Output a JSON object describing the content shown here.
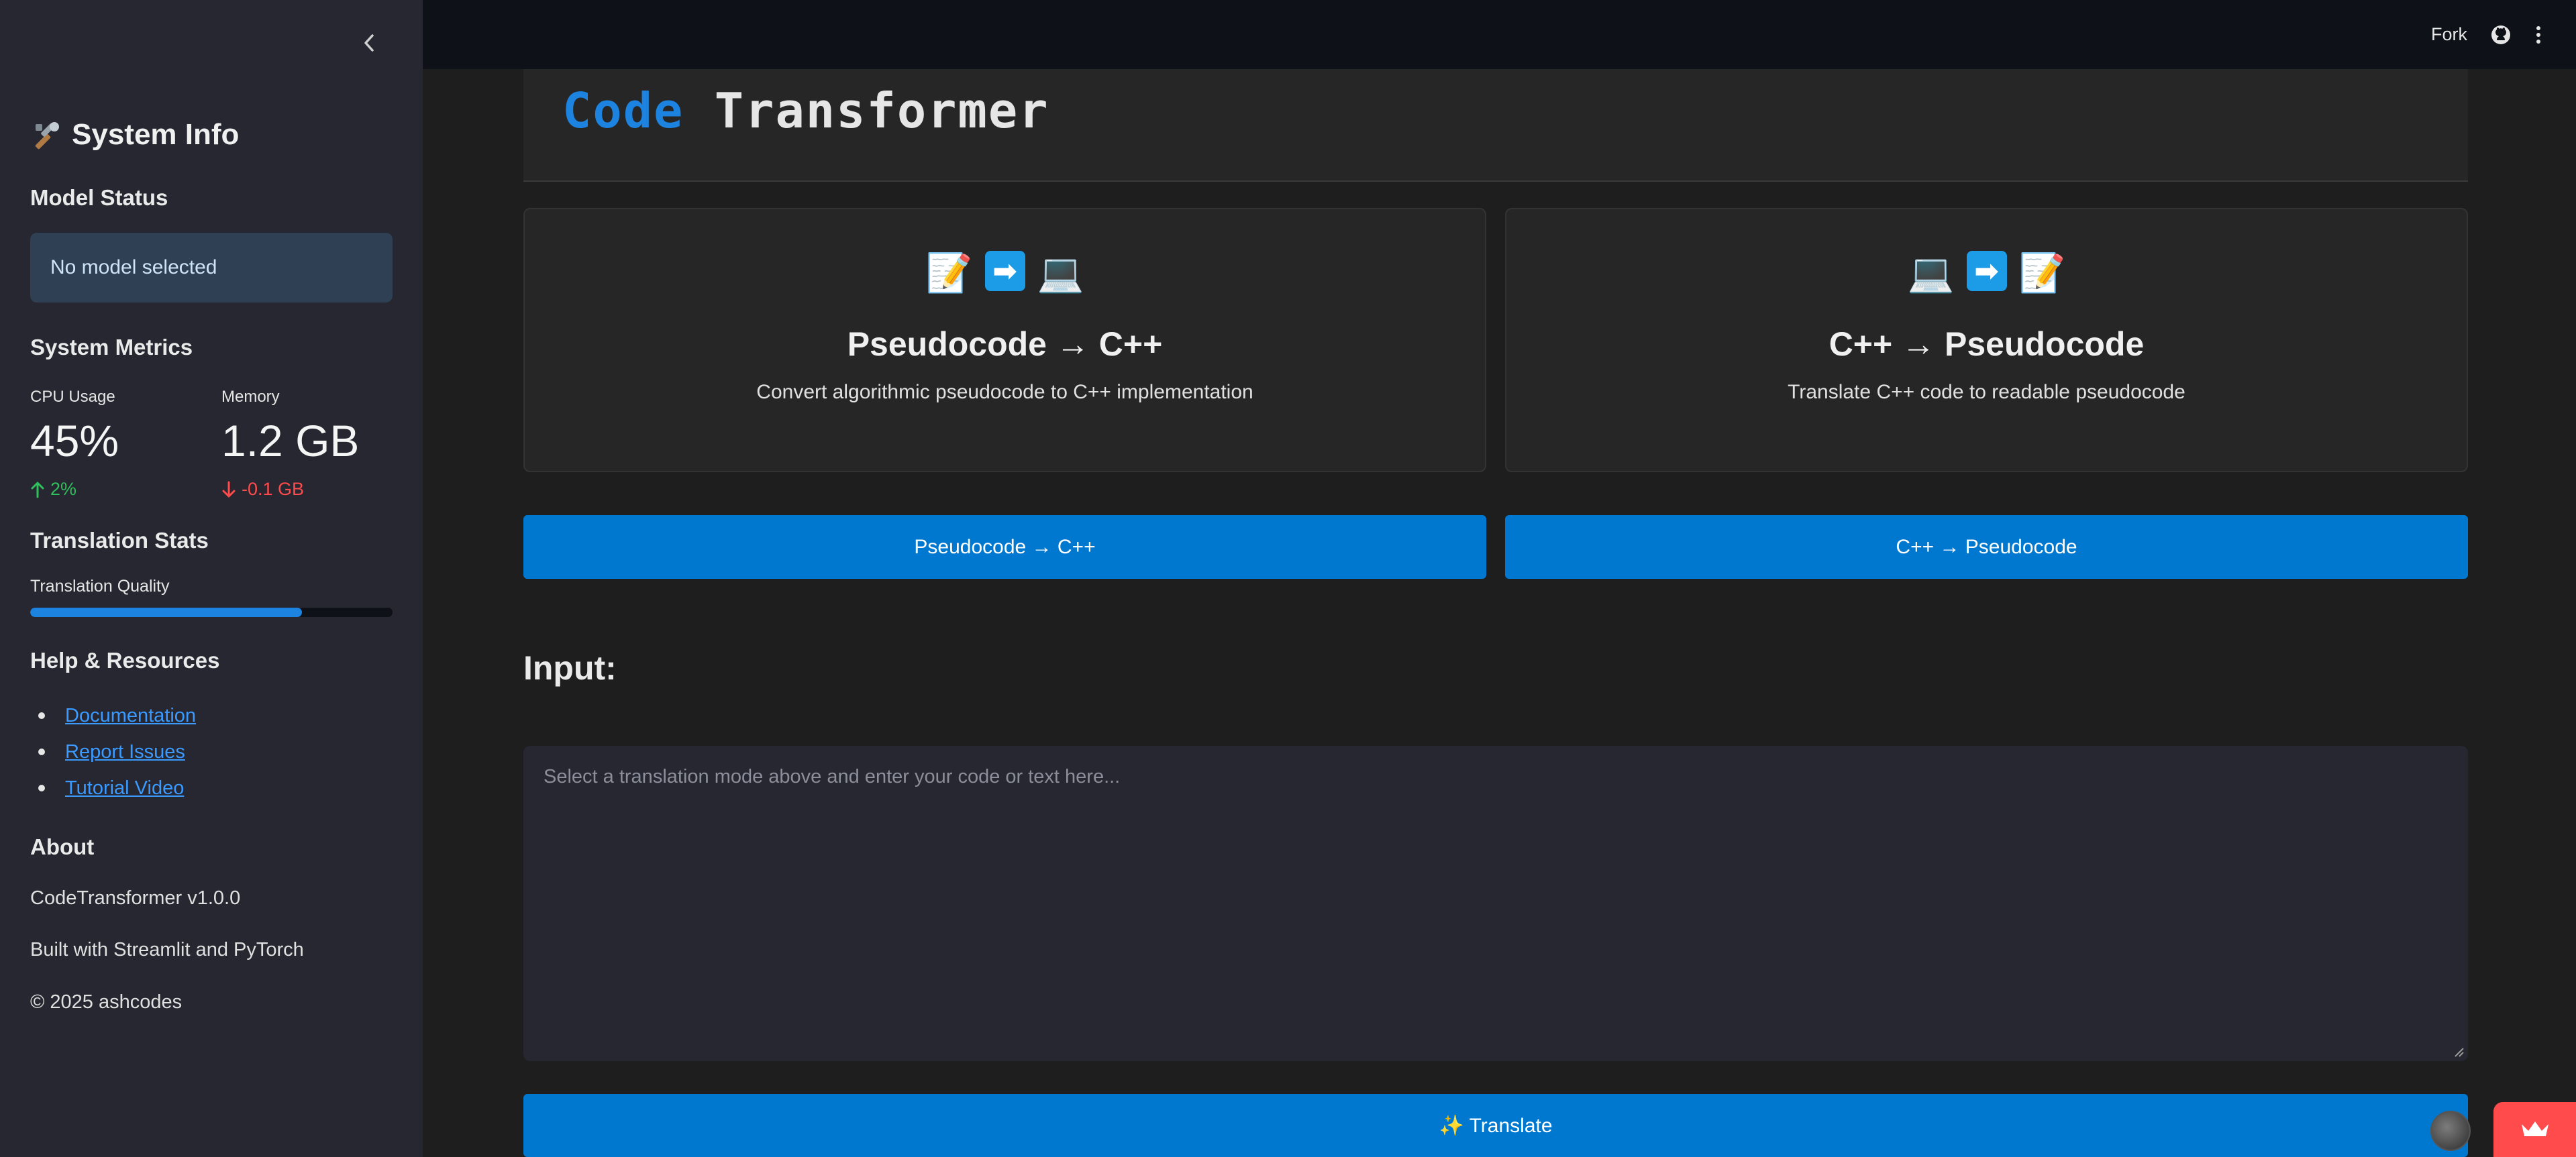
{
  "sidebar": {
    "title": "System Info",
    "title_icon": "tools-icon",
    "model_status": {
      "heading": "Model Status",
      "message": "No model selected"
    },
    "metrics": {
      "heading": "System Metrics",
      "cpu": {
        "label": "CPU Usage",
        "value": "45%",
        "delta": "2%",
        "direction": "up"
      },
      "memory": {
        "label": "Memory",
        "value": "1.2 GB",
        "delta": "-0.1 GB",
        "direction": "down"
      }
    },
    "translation_stats": {
      "heading": "Translation Stats",
      "quality_label": "Translation Quality",
      "quality_progress": 0.75
    },
    "help": {
      "heading": "Help & Resources",
      "links": [
        "Documentation",
        "Report Issues",
        "Tutorial Video"
      ]
    },
    "about": {
      "heading": "About",
      "version": "CodeTransformer v1.0.0",
      "built_with": "Built with Streamlit and PyTorch",
      "copyright": "© 2025 ashcodes"
    }
  },
  "topbar": {
    "fork_label": "Fork",
    "github_icon": "github-icon",
    "menu_icon": "kebab-menu-icon"
  },
  "header": {
    "title_accent": "Code",
    "title_rest": "Transformer"
  },
  "cards": [
    {
      "icons": [
        "📝",
        "➡",
        "💻"
      ],
      "title": "Pseudocode → C++",
      "description": "Convert algorithmic pseudocode to C++ implementation"
    },
    {
      "icons": [
        "💻",
        "➡",
        "📝"
      ],
      "title": "C++ → Pseudocode",
      "description": "Translate C++ code to readable pseudocode"
    }
  ],
  "mode_buttons": {
    "to_cpp": "Pseudocode → C++",
    "to_pseudo": "C++ → Pseudocode"
  },
  "input": {
    "label": "Input:",
    "placeholder": "Select a translation mode above and enter your code or text here..."
  },
  "translate_button": "✨ Translate",
  "colors": {
    "accent": "#1c83e1",
    "button": "#0078d0",
    "sidebar_bg": "#262730",
    "main_bg": "#1e1e1e",
    "up": "#2fbf5b",
    "down": "#ff4b4b"
  }
}
